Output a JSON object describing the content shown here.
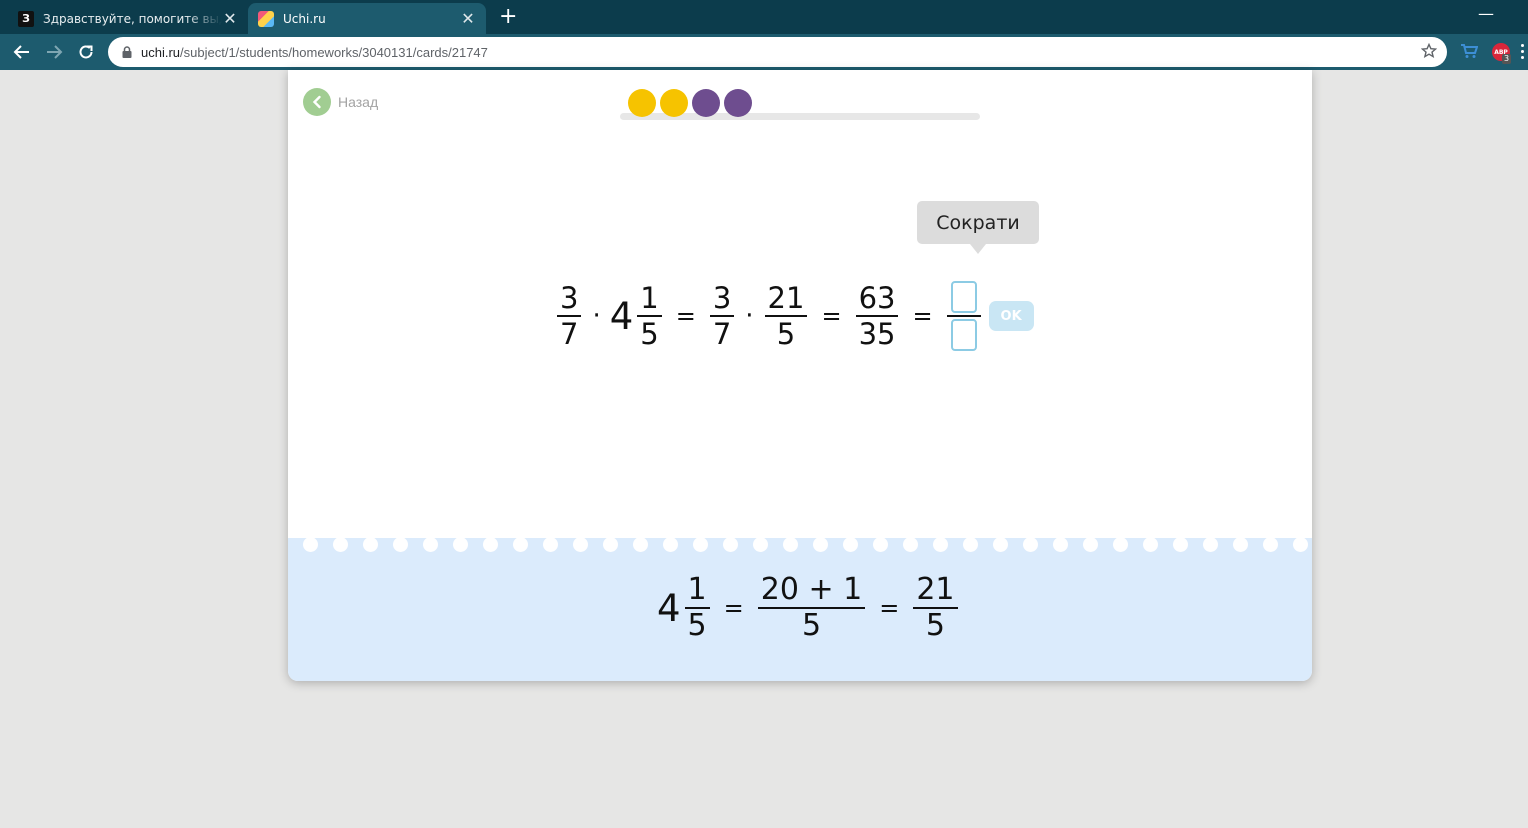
{
  "browser": {
    "tabs": [
      {
        "title": "Здравствуйте, помогите выделить",
        "favicon": "znanija-favicon-icon",
        "active": false
      },
      {
        "title": "Uchi.ru",
        "favicon": "uchi-favicon-icon",
        "active": true
      }
    ],
    "new_tab": "+",
    "url_host": "uchi.ru",
    "url_path": "/subject/1/students/homeworks/3040131/cards/21747",
    "extension_badge": "3",
    "extension_label": "ABP"
  },
  "page": {
    "back_label": "Назад",
    "progress_dots": [
      "#f6c300",
      "#f6c300",
      "#6e4d8f",
      "#6e4d8f"
    ],
    "tooltip": "Сократи",
    "equation": {
      "f1": {
        "num": "3",
        "den": "7"
      },
      "dot1": "·",
      "mixed": {
        "whole": "4",
        "num": "1",
        "den": "5"
      },
      "eq1": "=",
      "f2": {
        "num": "3",
        "den": "7"
      },
      "dot2": "·",
      "f3": {
        "num": "21",
        "den": "5"
      },
      "eq2": "=",
      "f4": {
        "num": "63",
        "den": "35"
      },
      "eq3": "=",
      "answer": {
        "num_value": "",
        "den_value": ""
      }
    },
    "ok_button": "OK",
    "hint": {
      "mixed": {
        "whole": "4",
        "num": "1",
        "den": "5"
      },
      "eq1": "=",
      "f1": {
        "num": "20 + 1",
        "den": "5"
      },
      "eq2": "=",
      "f2": {
        "num": "21",
        "den": "5"
      }
    }
  },
  "colors": {
    "tabbar": "#0c3c4c",
    "toolbar": "#1d5b6e",
    "back_button": "#a1cd92",
    "notepad": "#dbebfc",
    "input_border": "#8ccbe4",
    "ok_button": "#c9e6f4"
  }
}
